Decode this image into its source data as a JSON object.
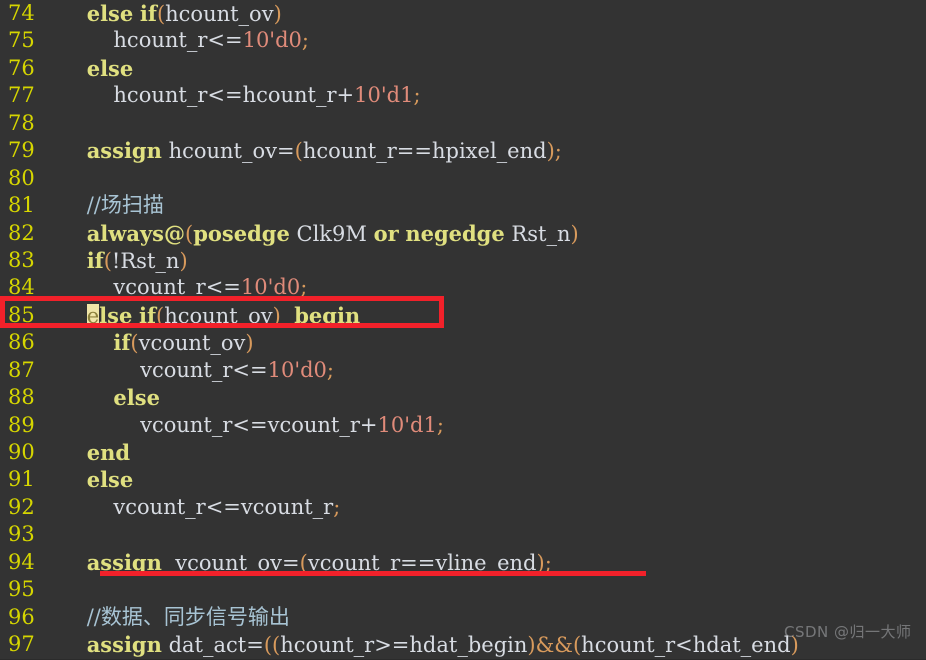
{
  "editor": {
    "background_color": "#333333",
    "gutter_color": "#d6d600",
    "default_text_color": "#d8dce3",
    "keyword_color": "#e0e080",
    "number_color": "#e08b7a",
    "punct_color": "#d89a5c",
    "comment_color": "#a8c4d4",
    "annotation_color": "#f2212a",
    "cursor_highlight_color": "#f0e6a8",
    "first_line_number": 74,
    "last_line_number": 97
  },
  "watermark": {
    "text": "CSDN @归一大师"
  },
  "lines": [
    {
      "num": "74",
      "text": "    else if(hcount_ov)",
      "tokens": [
        {
          "t": "    ",
          "c": "plain"
        },
        {
          "t": "else",
          "c": "kw"
        },
        {
          "t": " ",
          "c": "plain"
        },
        {
          "t": "if",
          "c": "kw"
        },
        {
          "t": "(",
          "c": "pun"
        },
        {
          "t": "hcount_ov",
          "c": "id"
        },
        {
          "t": ")",
          "c": "pun"
        }
      ]
    },
    {
      "num": "75",
      "text": "        hcount_r<=10'd0;",
      "tokens": [
        {
          "t": "        ",
          "c": "plain"
        },
        {
          "t": "hcount_r",
          "c": "id"
        },
        {
          "t": "<=",
          "c": "op"
        },
        {
          "t": "10'd0",
          "c": "num"
        },
        {
          "t": ";",
          "c": "pun"
        }
      ]
    },
    {
      "num": "76",
      "text": "    else",
      "tokens": [
        {
          "t": "    ",
          "c": "plain"
        },
        {
          "t": "else",
          "c": "kw"
        }
      ]
    },
    {
      "num": "77",
      "text": "        hcount_r<=hcount_r+10'd1;",
      "tokens": [
        {
          "t": "        ",
          "c": "plain"
        },
        {
          "t": "hcount_r",
          "c": "id"
        },
        {
          "t": "<=",
          "c": "op"
        },
        {
          "t": "hcount_r",
          "c": "id"
        },
        {
          "t": "+",
          "c": "op"
        },
        {
          "t": "10'd1",
          "c": "num"
        },
        {
          "t": ";",
          "c": "pun"
        }
      ]
    },
    {
      "num": "78",
      "text": "",
      "tokens": []
    },
    {
      "num": "79",
      "text": "    assign hcount_ov=(hcount_r==hpixel_end);",
      "tokens": [
        {
          "t": "    ",
          "c": "plain"
        },
        {
          "t": "assign",
          "c": "kw"
        },
        {
          "t": " ",
          "c": "plain"
        },
        {
          "t": "hcount_ov",
          "c": "id"
        },
        {
          "t": "=",
          "c": "op"
        },
        {
          "t": "(",
          "c": "pun"
        },
        {
          "t": "hcount_r",
          "c": "id"
        },
        {
          "t": "==",
          "c": "op"
        },
        {
          "t": "hpixel_end",
          "c": "id"
        },
        {
          "t": ")",
          "c": "pun"
        },
        {
          "t": ";",
          "c": "pun"
        }
      ]
    },
    {
      "num": "80",
      "text": "",
      "tokens": []
    },
    {
      "num": "81",
      "text": "    //场扫描",
      "tokens": [
        {
          "t": "    ",
          "c": "plain"
        },
        {
          "t": "//场扫描",
          "c": "cmt"
        }
      ]
    },
    {
      "num": "82",
      "text": "    always@(posedge Clk9M or negedge Rst_n)",
      "tokens": [
        {
          "t": "    ",
          "c": "plain"
        },
        {
          "t": "always@",
          "c": "kw"
        },
        {
          "t": "(",
          "c": "pun"
        },
        {
          "t": "posedge",
          "c": "kw"
        },
        {
          "t": " ",
          "c": "plain"
        },
        {
          "t": "Clk9M",
          "c": "id"
        },
        {
          "t": " ",
          "c": "plain"
        },
        {
          "t": "or",
          "c": "kw"
        },
        {
          "t": " ",
          "c": "plain"
        },
        {
          "t": "negedge",
          "c": "kw"
        },
        {
          "t": " ",
          "c": "plain"
        },
        {
          "t": "Rst_n",
          "c": "id"
        },
        {
          "t": ")",
          "c": "pun"
        }
      ]
    },
    {
      "num": "83",
      "text": "    if(!Rst_n)",
      "tokens": [
        {
          "t": "    ",
          "c": "plain"
        },
        {
          "t": "if",
          "c": "kw"
        },
        {
          "t": "(",
          "c": "pun"
        },
        {
          "t": "!",
          "c": "op"
        },
        {
          "t": "Rst_n",
          "c": "id"
        },
        {
          "t": ")",
          "c": "pun"
        }
      ]
    },
    {
      "num": "84",
      "text": "        vcount_r<=10'd0;",
      "tokens": [
        {
          "t": "        ",
          "c": "plain"
        },
        {
          "t": "vcount_r",
          "c": "id"
        },
        {
          "t": "<=",
          "c": "op"
        },
        {
          "t": "10'd0",
          "c": "num"
        },
        {
          "t": ";",
          "c": "pun"
        }
      ]
    },
    {
      "num": "85",
      "text": "    else if(hcount_ov) begin",
      "cursor_at": 4,
      "tokens": [
        {
          "t": "    ",
          "c": "plain"
        },
        {
          "t": "e",
          "c": "cursor-char"
        },
        {
          "t": "lse",
          "c": "kw"
        },
        {
          "t": " ",
          "c": "plain"
        },
        {
          "t": "if",
          "c": "kw"
        },
        {
          "t": "(",
          "c": "pun"
        },
        {
          "t": "hcount_ov",
          "c": "id"
        },
        {
          "t": ")",
          "c": "pun"
        },
        {
          "t": "  ",
          "c": "plain"
        },
        {
          "t": "begin",
          "c": "kw"
        }
      ]
    },
    {
      "num": "86",
      "text": "        if(vcount_ov)",
      "tokens": [
        {
          "t": "        ",
          "c": "plain"
        },
        {
          "t": "if",
          "c": "kw"
        },
        {
          "t": "(",
          "c": "pun"
        },
        {
          "t": "vcount_ov",
          "c": "id"
        },
        {
          "t": ")",
          "c": "pun"
        }
      ]
    },
    {
      "num": "87",
      "text": "            vcount_r<=10'd0;",
      "tokens": [
        {
          "t": "            ",
          "c": "plain"
        },
        {
          "t": "vcount_r",
          "c": "id"
        },
        {
          "t": "<=",
          "c": "op"
        },
        {
          "t": "10'd0",
          "c": "num"
        },
        {
          "t": ";",
          "c": "pun"
        }
      ]
    },
    {
      "num": "88",
      "text": "        else",
      "tokens": [
        {
          "t": "        ",
          "c": "plain"
        },
        {
          "t": "else",
          "c": "kw"
        }
      ]
    },
    {
      "num": "89",
      "text": "            vcount_r<=vcount_r+10'd1;",
      "tokens": [
        {
          "t": "            ",
          "c": "plain"
        },
        {
          "t": "vcount_r",
          "c": "id"
        },
        {
          "t": "<=",
          "c": "op"
        },
        {
          "t": "vcount_r",
          "c": "id"
        },
        {
          "t": "+",
          "c": "op"
        },
        {
          "t": "10'd1",
          "c": "num"
        },
        {
          "t": ";",
          "c": "pun"
        }
      ]
    },
    {
      "num": "90",
      "text": "    end",
      "tokens": [
        {
          "t": "    ",
          "c": "plain"
        },
        {
          "t": "end",
          "c": "kw"
        }
      ]
    },
    {
      "num": "91",
      "text": "    else",
      "tokens": [
        {
          "t": "    ",
          "c": "plain"
        },
        {
          "t": "else",
          "c": "kw"
        }
      ]
    },
    {
      "num": "92",
      "text": "        vcount_r<=vcount_r;",
      "tokens": [
        {
          "t": "        ",
          "c": "plain"
        },
        {
          "t": "vcount_r",
          "c": "id"
        },
        {
          "t": "<=",
          "c": "op"
        },
        {
          "t": "vcount_r",
          "c": "id"
        },
        {
          "t": ";",
          "c": "pun"
        }
      ]
    },
    {
      "num": "93",
      "text": "",
      "tokens": []
    },
    {
      "num": "94",
      "text": "    assign  vcount_ov=(vcount_r==vline_end);",
      "tokens": [
        {
          "t": "    ",
          "c": "plain"
        },
        {
          "t": "assign",
          "c": "kw"
        },
        {
          "t": "  ",
          "c": "plain"
        },
        {
          "t": "vcount_ov",
          "c": "id"
        },
        {
          "t": "=",
          "c": "op"
        },
        {
          "t": "(",
          "c": "pun"
        },
        {
          "t": "vcount_r",
          "c": "id"
        },
        {
          "t": "==",
          "c": "op"
        },
        {
          "t": "vline_end",
          "c": "id"
        },
        {
          "t": ")",
          "c": "pun"
        },
        {
          "t": ";",
          "c": "pun"
        }
      ]
    },
    {
      "num": "95",
      "text": "",
      "tokens": []
    },
    {
      "num": "96",
      "text": "    //数据、同步信号输出",
      "tokens": [
        {
          "t": "    ",
          "c": "plain"
        },
        {
          "t": "//数据、同步信号输出",
          "c": "cmt"
        }
      ]
    },
    {
      "num": "97",
      "text": "    assign dat_act=((hcount_r>=hdat_begin)&&(hcount_r<hdat_end)",
      "tokens": [
        {
          "t": "    ",
          "c": "plain"
        },
        {
          "t": "assign",
          "c": "kw"
        },
        {
          "t": " ",
          "c": "plain"
        },
        {
          "t": "dat_act",
          "c": "id"
        },
        {
          "t": "=",
          "c": "op"
        },
        {
          "t": "(",
          "c": "pun"
        },
        {
          "t": "(",
          "c": "pun"
        },
        {
          "t": "hcount_r",
          "c": "id"
        },
        {
          "t": ">=",
          "c": "op"
        },
        {
          "t": "hdat_begin",
          "c": "id"
        },
        {
          "t": ")",
          "c": "pun"
        },
        {
          "t": "&&",
          "c": "pun"
        },
        {
          "t": "(",
          "c": "pun"
        },
        {
          "t": "hcount_r",
          "c": "id"
        },
        {
          "t": "<",
          "c": "op"
        },
        {
          "t": "hdat_end",
          "c": "id"
        },
        {
          "t": ")",
          "c": "pun"
        }
      ]
    }
  ],
  "annotations": {
    "highlight_box": {
      "line": "85",
      "color": "#f2212a",
      "shape": "rectangle"
    },
    "underline": {
      "line": "94",
      "color": "#f2212a",
      "shape": "underline"
    }
  }
}
